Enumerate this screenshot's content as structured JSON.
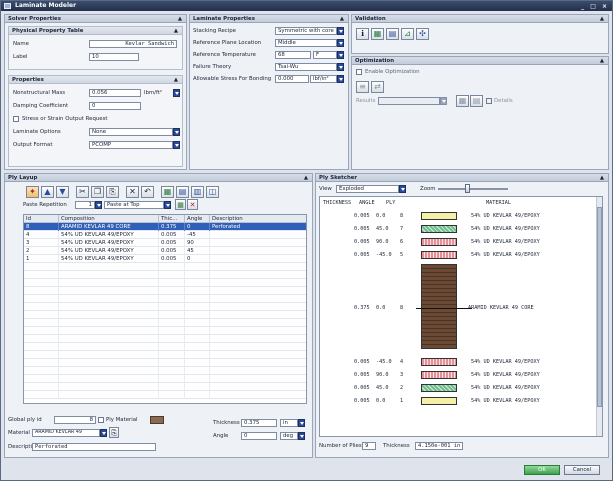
{
  "window": {
    "title": "Laminate Modeler",
    "controls": "_ □ ×"
  },
  "solver": {
    "title": "Solver Properties",
    "physical": {
      "title": "Physical Property Table",
      "name_label": "Name",
      "name_value": "Kevlar Sandwich",
      "label_label": "Label",
      "label_value": "10"
    },
    "properties": {
      "title": "Properties",
      "nsm_label": "Nonstructural Mass",
      "nsm_value": "0.056",
      "nsm_unit": "lbm/ft²",
      "damping_label": "Damping Coefficient",
      "damping_value": "0",
      "stress_label": "Stress or Strain Output Request",
      "options_label": "Laminate Options",
      "options_value": "None",
      "format_label": "Output Format",
      "format_value": "PCOMP"
    }
  },
  "laminate": {
    "title": "Laminate Properties",
    "stacking_label": "Stacking Recipe",
    "stacking_value": "Symmetric with core",
    "ref_plane_label": "Reference Plane Location",
    "ref_plane_value": "Middle",
    "ref_temp_label": "Reference Temperature",
    "ref_temp_value": "68",
    "ref_temp_unit": "F",
    "failure_label": "Failure Theory",
    "failure_value": "Tsai-Wu",
    "allow_label": "Allowable Stress For Bonding",
    "allow_value": "0.000",
    "allow_unit": "lbf/in²"
  },
  "validation": {
    "title": "Validation"
  },
  "optimization": {
    "title": "Optimization",
    "enable_label": "Enable Optimization",
    "results_label": "Results",
    "details_label": "Details"
  },
  "ply_layup": {
    "title": "Ply Layup",
    "repetition_label": "Paste Repetition",
    "repetition_value": "1",
    "paste_value": "Paste at Top",
    "columns": [
      "Id",
      "Composition",
      "Thic...",
      "Angle",
      "Description"
    ],
    "rows": [
      {
        "id": "8",
        "composition": "ARAMID KEVLAR 49 CORE",
        "thickness": "0.375",
        "angle": "0",
        "description": "Perforated"
      },
      {
        "id": "4",
        "composition": "54% UD KEVLAR 49/EPOXY",
        "thickness": "0.005",
        "angle": "-45",
        "description": ""
      },
      {
        "id": "3",
        "composition": "54% UD KEVLAR 49/EPOXY",
        "thickness": "0.005",
        "angle": "90",
        "description": ""
      },
      {
        "id": "2",
        "composition": "54% UD KEVLAR 49/EPOXY",
        "thickness": "0.005",
        "angle": "45",
        "description": ""
      },
      {
        "id": "1",
        "composition": "54% UD KEVLAR 49/EPOXY",
        "thickness": "0.005",
        "angle": "0",
        "description": ""
      }
    ],
    "global_ply_label": "Global ply id",
    "global_ply_value": "8",
    "ply_material_label": "Ply Material",
    "material_label": "Material",
    "material_value": "ARAMID KEVLAR 49",
    "description_label": "Description",
    "description_value": "Perforated",
    "thickness_label": "Thickness",
    "thickness_value": "0.375",
    "thickness_unit": "in",
    "angle_label": "Angle",
    "angle_value": "0",
    "angle_unit": "deg"
  },
  "ply_sketcher": {
    "title": "Ply Sketcher",
    "view_label": "View",
    "view_value": "Exploded",
    "zoom_label": "Zoom",
    "headers": [
      "THICKNESS",
      "ANGLE",
      "PLY",
      "MATERIAL"
    ],
    "plies": [
      {
        "thickness": "0.005",
        "angle": "0.0",
        "ply": "8",
        "material": "54% UD KEVLAR 49/EPOXY",
        "pattern": "yellow"
      },
      {
        "thickness": "0.005",
        "angle": "45.0",
        "ply": "7",
        "material": "54% UD KEVLAR 49/EPOXY",
        "pattern": "green"
      },
      {
        "thickness": "0.005",
        "angle": "90.0",
        "ply": "6",
        "material": "54% UD KEVLAR 49/EPOXY",
        "pattern": "red"
      },
      {
        "thickness": "0.005",
        "angle": "-45.0",
        "ply": "5",
        "material": "54% UD KEVLAR 49/EPOXY",
        "pattern": "red"
      },
      {
        "thickness": "0.375",
        "angle": "0.0",
        "ply": "8",
        "material": "ARAMID KEVLAR 49 CORE",
        "pattern": "core"
      },
      {
        "thickness": "0.005",
        "angle": "-45.0",
        "ply": "4",
        "material": "54% UD KEVLAR 49/EPOXY",
        "pattern": "red"
      },
      {
        "thickness": "0.005",
        "angle": "90.0",
        "ply": "3",
        "material": "54% UD KEVLAR 49/EPOXY",
        "pattern": "red"
      },
      {
        "thickness": "0.005",
        "angle": "45.0",
        "ply": "2",
        "material": "54% UD KEVLAR 49/EPOXY",
        "pattern": "green"
      },
      {
        "thickness": "0.005",
        "angle": "0.0",
        "ply": "1",
        "material": "54% UD KEVLAR 49/EPOXY",
        "pattern": "yellow"
      }
    ],
    "num_plies_label": "Number of Plies",
    "num_plies_value": "9",
    "total_thickness_label": "Thickness",
    "total_thickness_value": "4.150e-001",
    "total_thickness_unit": "in"
  },
  "footer": {
    "ok_label": "OK",
    "cancel_label": "Cancel"
  },
  "colors": {
    "yellow": "#f4f0a8",
    "green": "#6fbf8e",
    "red": "#e58f97",
    "core": "#6b4a35",
    "selection": "#2f5fb8",
    "ok_green": "#4caf50"
  }
}
